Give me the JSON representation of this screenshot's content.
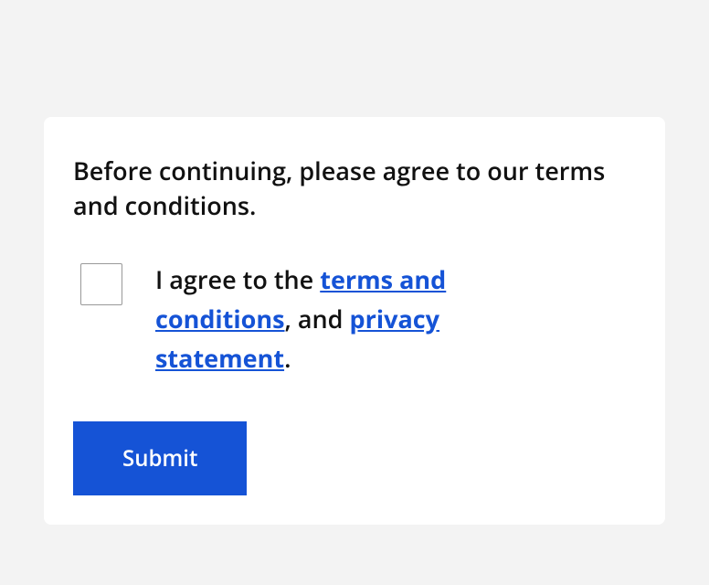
{
  "intro": "Before continuing, please agree to our terms and conditions.",
  "checkbox": {
    "prefix": "I agree to the ",
    "terms_link": "terms and conditions",
    "separator": ", and ",
    "privacy_link": "privacy statement",
    "suffix": "."
  },
  "submit_label": "Submit"
}
